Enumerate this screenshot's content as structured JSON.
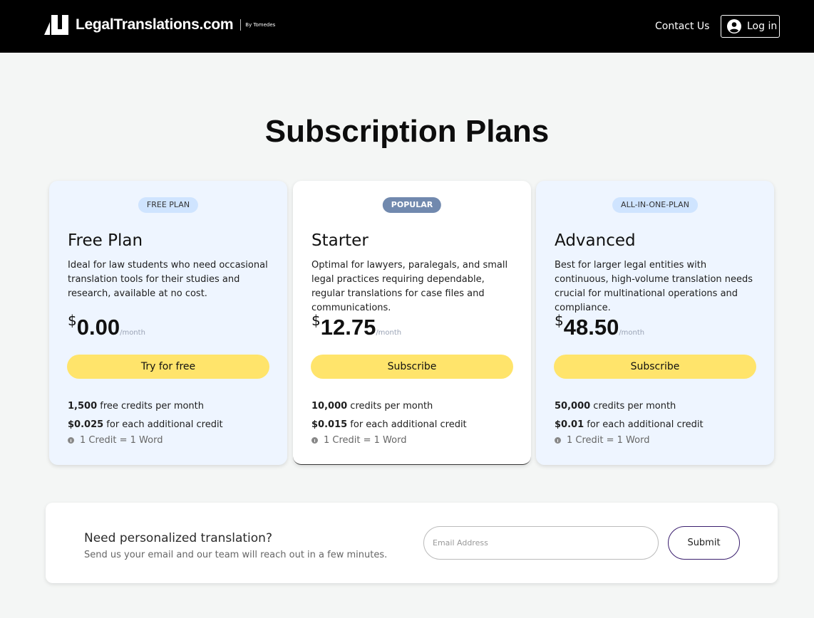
{
  "header": {
    "logo_text": "LegalTranslations.com",
    "logo_by": "By Tomedes",
    "contact_label": "Contact Us",
    "login_label": "Log in"
  },
  "page_title": "Subscription Plans",
  "plans": [
    {
      "badge": "FREE PLAN",
      "name": "Free Plan",
      "description": "Ideal for law students who need occasional translation tools for their studies and research, available at no cost.",
      "currency": "$",
      "price": "0.00",
      "period": "/month",
      "cta": "Try for free",
      "credits_value": "1,500",
      "credits_text": " free credits per month",
      "extra_value": "$0.025",
      "extra_text": " for each additional credit",
      "note": "1 Credit = 1 Word"
    },
    {
      "badge": "POPULAR",
      "name": "Starter",
      "description": "Optimal for lawyers, paralegals, and small legal practices requiring dependable, regular translations for case files and communications.",
      "currency": "$",
      "price": "12.75",
      "period": "/month",
      "cta": "Subscribe",
      "credits_value": "10,000",
      "credits_text": " credits per month",
      "extra_value": "$0.015",
      "extra_text": " for each additional credit",
      "note": "1 Credit = 1 Word"
    },
    {
      "badge": "ALL-IN-ONE-PLAN",
      "name": "Advanced",
      "description": "Best for larger legal entities with continuous, high-volume translation needs crucial for multinational operations and compliance.",
      "currency": "$",
      "price": "48.50",
      "period": "/month",
      "cta": "Subscribe",
      "credits_value": "50,000",
      "credits_text": " credits per month",
      "extra_value": "$0.01",
      "extra_text": " for each additional credit",
      "note": "1 Credit = 1 Word"
    }
  ],
  "contact_panel": {
    "title": "Need personalized translation?",
    "subtitle": "Send us your email and our team will reach out in a few minutes.",
    "email_placeholder": "Email Address",
    "email_value": "",
    "submit_label": "Submit"
  },
  "colors": {
    "header_bg": "#000000",
    "cta_yellow": "#ffe46b",
    "popular_badge": "#7189ae",
    "plan_badge": "#cfe4ff",
    "card_bg": "#eef5ff",
    "submit_border": "#3b1f6e"
  }
}
